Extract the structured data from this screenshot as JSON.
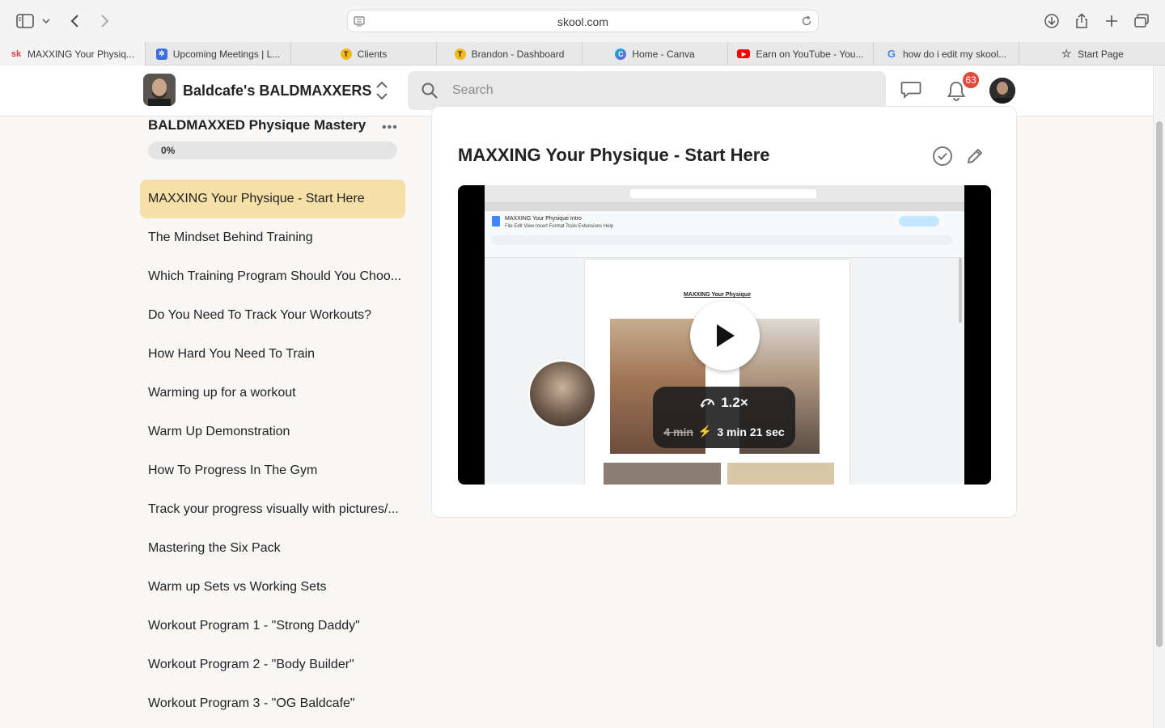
{
  "browser": {
    "url": "skool.com",
    "tabs": [
      {
        "label": "MAXXING Your Physiq...",
        "favicon": "sk",
        "color": "#e53935"
      },
      {
        "label": "Upcoming Meetings | L...",
        "favicon": "gear",
        "color": "#3b6fe0"
      },
      {
        "label": "Clients",
        "favicon": "T",
        "color": "#f3b81a"
      },
      {
        "label": "Brandon - Dashboard",
        "favicon": "T",
        "color": "#f3b81a"
      },
      {
        "label": "Home - Canva",
        "favicon": "C",
        "color": "#7d4ce6"
      },
      {
        "label": "Earn on YouTube - You...",
        "favicon": "play",
        "color": "#ff0000"
      },
      {
        "label": "how do i edit my skool...",
        "favicon": "G",
        "color": "#4285f4"
      },
      {
        "label": "Start Page",
        "favicon": "star",
        "color": "#666666"
      }
    ]
  },
  "header": {
    "group_name": "Baldcafe's BALDMAXXERS",
    "search_placeholder": "Search",
    "notification_count": "63"
  },
  "sidebar": {
    "course_title": "BALDMAXXED Physique Mastery",
    "progress_label": "0%",
    "progress_value": 0,
    "lessons": [
      "MAXXING Your Physique - Start Here",
      "The Mindset Behind Training",
      "Which Training Program Should You Choo...",
      "Do You Need To Track Your Workouts?",
      "How Hard You Need To Train",
      "Warming up for a workout",
      "Warm Up Demonstration",
      "How To Progress In The Gym",
      "Track your progress visually with pictures/...",
      "Mastering the Six Pack",
      "Warm up Sets vs Working Sets",
      "Workout Program 1 - \"Strong Daddy\"",
      "Workout Program 2 - \"Body Builder\"",
      "Workout Program 3 - \"OG Baldcafe\""
    ],
    "active_index": 0
  },
  "content": {
    "lesson_title": "MAXXING Your Physique - Start Here",
    "video": {
      "doc_name": "MAXXING Your Physique Intro",
      "doc_menu": "File   Edit   View   Insert   Format   Tools   Extensions   Help",
      "doc_heading": "MAXXING Your Physique",
      "speed": "1.2×",
      "original_time": "4 min",
      "fast_time": "3 min 21 sec"
    }
  },
  "colors": {
    "active_lesson_bg": "#f5e0a8",
    "badge": "#e44b3a"
  }
}
